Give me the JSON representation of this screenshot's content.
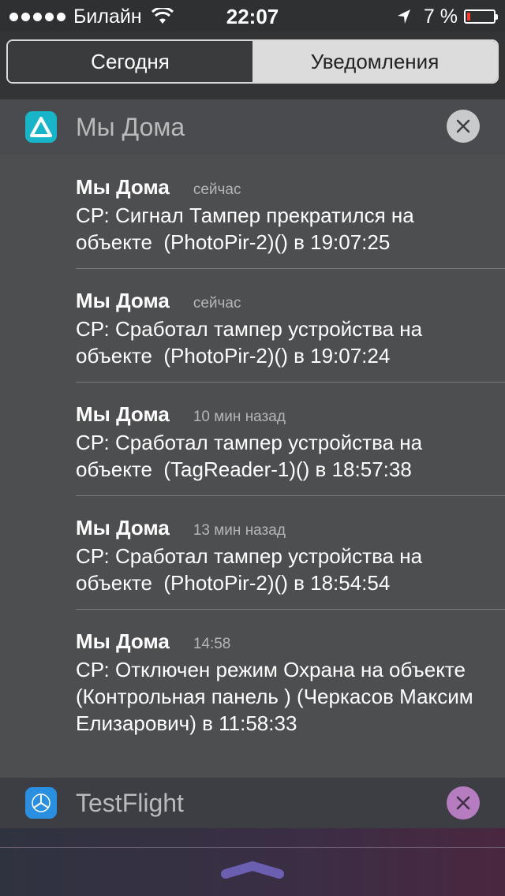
{
  "status_bar": {
    "carrier": "Билайн",
    "time": "22:07",
    "battery": "7 %"
  },
  "tabs": [
    {
      "label": "Сегодня",
      "selected": false
    },
    {
      "label": "Уведомления",
      "selected": true
    }
  ],
  "apps": [
    {
      "name": "Мы Дома",
      "icon": "triangle-app-icon",
      "notifications": [
        {
          "title": "Мы Дома",
          "time": "сейчас",
          "body": "СР: Сигнал Тампер прекратился на объекте  (PhotoPir-2)() в 19:07:25"
        },
        {
          "title": "Мы Дома",
          "time": "сейчас",
          "body": "СР: Сработал тампер устройства на объекте  (PhotoPir-2)() в 19:07:24"
        },
        {
          "title": "Мы Дома",
          "time": "10 мин назад",
          "body": "СР: Сработал тампер устройства на объекте  (TagReader-1)() в 18:57:38"
        },
        {
          "title": "Мы Дома",
          "time": "13 мин назад",
          "body": "СР: Сработал тампер устройства на объекте  (PhotoPir-2)() в 18:54:54"
        },
        {
          "title": "Мы Дома",
          "time": "14:58",
          "body": "СР: Отключен режим Охрана на объекте  (Контрольная панель ) (Черкасов Максим Елизарович) в 11:58:33"
        }
      ]
    },
    {
      "name": "TestFlight",
      "icon": "testflight-icon",
      "notifications": []
    }
  ],
  "colors": {
    "app_accent": "#18b5c9",
    "testflight_blue": "#2a8fe0",
    "handle_purple": "#6a5fb0"
  }
}
